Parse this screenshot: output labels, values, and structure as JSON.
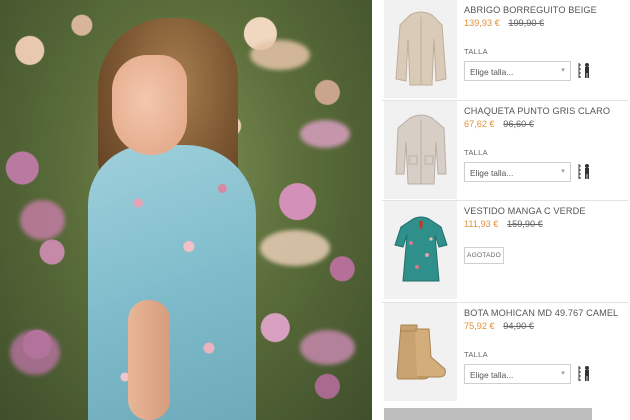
{
  "colors": {
    "price_accent": "#e0913b",
    "text": "#555555",
    "border": "#cfcfcf"
  },
  "products": [
    {
      "name": "ABRIGO BORREGUITO BEIGE",
      "price": "139,93 €",
      "old_price": "199,90 €",
      "size_label": "TALLA",
      "size_select_placeholder": "Elige talla...",
      "icon": "size-guide-icon"
    },
    {
      "name": "CHAQUETA PUNTO GRIS CLARO",
      "price": "67,62 €",
      "old_price": "96,60 €",
      "size_label": "TALLA",
      "size_select_placeholder": "Elige talla...",
      "icon": "size-guide-icon"
    },
    {
      "name": "VESTIDO MANGA C VERDE",
      "price": "111,93 €",
      "old_price": "159,90 €",
      "status": "AGOTADO"
    },
    {
      "name": "BOTA MOHICAN MD 49.767 CAMEL",
      "price": "75,92 €",
      "old_price": "94,90 €",
      "size_label": "TALLA",
      "size_select_placeholder": "Elige talla...",
      "icon": "size-guide-icon"
    }
  ]
}
